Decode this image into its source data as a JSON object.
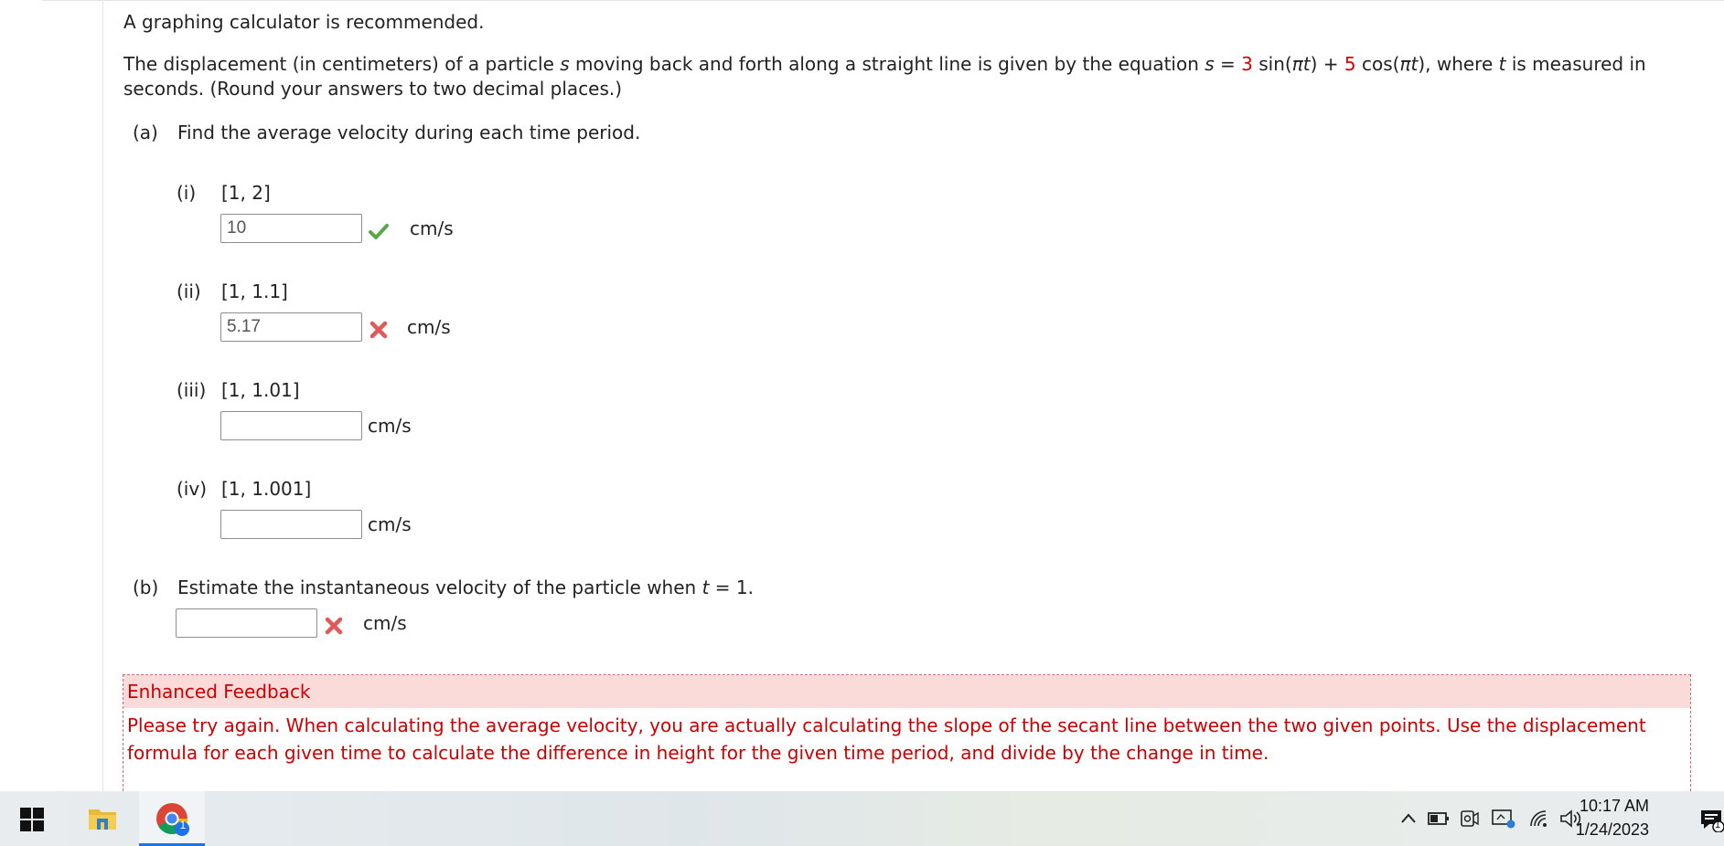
{
  "intro": "A graphing calculator is recommended.",
  "problem": {
    "text1": "The displacement (in centimeters) of a particle ",
    "var_s": "s",
    "text2": " moving back and forth along a straight line is given by the equation ",
    "var_s2": "s",
    "text3": " = ",
    "coef1": "3",
    "text4": " sin(",
    "pi1": "π",
    "var_t1": "t",
    "text5": ") + ",
    "coef2": "5",
    "text6": " cos(",
    "pi2": "π",
    "var_t2": "t",
    "text7": "), where ",
    "var_t3": "t",
    "text8": " is measured in",
    "line2": "seconds. (Round your answers to two decimal places.)"
  },
  "part_a": {
    "label": "(a)",
    "prompt": "Find the average velocity during each time period.",
    "items": [
      {
        "num": "(i)",
        "interval": "[1, 2]",
        "value": "10",
        "unit": "cm/s",
        "status": "correct"
      },
      {
        "num": "(ii)",
        "interval": "[1, 1.1]",
        "value": "5.17",
        "unit": "cm/s",
        "status": "incorrect"
      },
      {
        "num": "(iii)",
        "interval": "[1, 1.01]",
        "value": "",
        "unit": "cm/s",
        "status": "none"
      },
      {
        "num": "(iv)",
        "interval": "[1, 1.001]",
        "value": "",
        "unit": "cm/s",
        "status": "none"
      }
    ]
  },
  "part_b": {
    "label": "(b)",
    "prompt_pre": "Estimate the instantaneous velocity of the particle when ",
    "var_t": "t",
    "prompt_post": " = 1.",
    "value": "",
    "unit": "cm/s",
    "status": "incorrect"
  },
  "feedback": {
    "title": "Enhanced Feedback",
    "body": "Please try again. When calculating the average velocity, you are actually calculating the slope of the secant line between the two given points. Use the displacement formula for each given time to calculate the difference in height for the given time period, and divide by the change in time."
  },
  "taskbar": {
    "time": "10:17 AM",
    "date": "1/24/2023",
    "chrome_badge": "1",
    "notification_badge": "1"
  },
  "colors": {
    "accent_red": "#d90000",
    "check_green": "#5aa949",
    "cross_red": "#e05a5a",
    "feedback_bg": "#fbdada"
  }
}
